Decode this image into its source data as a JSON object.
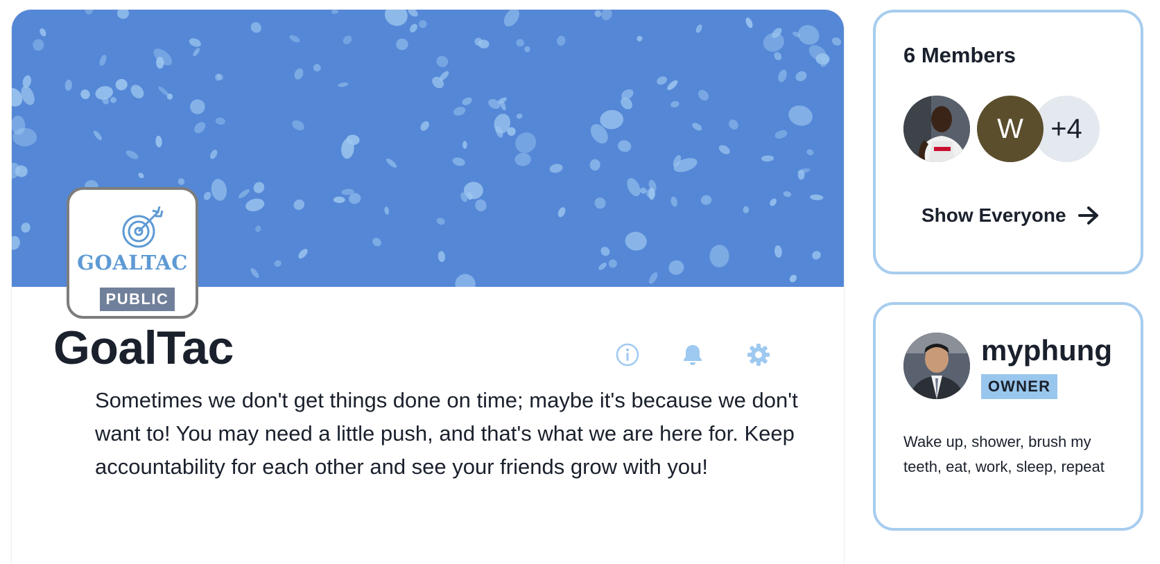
{
  "group": {
    "logo_text": "GOALTAC",
    "visibility_badge": "PUBLIC",
    "title": "GoalTac",
    "description": "Sometimes we don't get things done on time; maybe it's because we don't want to! You may need a little push, and that's what we are here for. Keep accountability for each other and see your friends grow with you!",
    "actions": [
      {
        "icon": "info-icon"
      },
      {
        "icon": "bell-icon"
      },
      {
        "icon": "gear-icon"
      }
    ]
  },
  "members": {
    "title": "6 Members",
    "avatars": [
      {
        "type": "photo"
      },
      {
        "type": "initial",
        "label": "W"
      },
      {
        "type": "overflow",
        "label": "+4"
      }
    ],
    "show_all_label": "Show Everyone"
  },
  "owner": {
    "name": "myphung",
    "role_badge": "OWNER",
    "bio": "Wake up, shower, brush my teeth, eat, work, sleep, repeat"
  },
  "colors": {
    "banner": "#5487d6",
    "accent_light": "#a7cdee",
    "icon_blue": "#9ec9f0",
    "public_badge": "#71809a",
    "owner_badge": "#99c6ec",
    "text": "#1a202c"
  }
}
